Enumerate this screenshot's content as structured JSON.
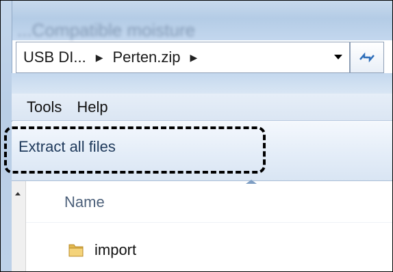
{
  "window": {
    "title_blurred": "...Compatible moisture"
  },
  "address_bar": {
    "crumbs": [
      "USB DI...",
      "Perten.zip"
    ]
  },
  "menu": {
    "items": [
      "Tools",
      "Help"
    ]
  },
  "command_bar": {
    "extract_label": "Extract all files"
  },
  "file_list": {
    "column_header": "Name",
    "items": [
      {
        "name": "import",
        "icon": "folder-icon"
      }
    ]
  },
  "colors": {
    "accent": "#1e395b",
    "highlight_border": "#000000"
  }
}
